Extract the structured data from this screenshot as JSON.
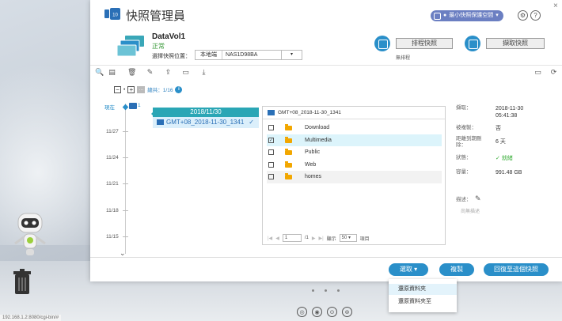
{
  "app": {
    "title": "快照管理員",
    "space_label": "最小快照保護空間",
    "close_glyph": "×",
    "gear_glyph": "⚙",
    "help_glyph": "?"
  },
  "volume": {
    "name": "DataVol1",
    "status": "正常",
    "select_location_label": "選擇快照位置：",
    "location_local": "本地端",
    "location_nas": "NAS1D98BA",
    "location_arrow": "▾"
  },
  "actions": {
    "schedule_label": "排程快照",
    "schedule_status": "無排程",
    "take_snapshot_label": "擷取快照"
  },
  "toolbar": {
    "icons": [
      "search-icon",
      "filter-icon",
      "trash-icon",
      "edit-icon",
      "upload-icon",
      "folder-open-icon",
      "download-icon",
      "window-icon",
      "refresh-icon"
    ],
    "glyphs": [
      "🔍",
      "▤",
      "🗑",
      "✎",
      "⇪",
      "▭",
      "⤓",
      "▭",
      "⟳"
    ]
  },
  "filter": {
    "tag_label": "…",
    "total_label": "總共：1/16",
    "info_glyph": "i",
    "minus_glyph": "−",
    "plus_glyph": "+"
  },
  "timeline": {
    "now_label": "現在",
    "now_count": "1",
    "dates": [
      "11/27",
      "11/24",
      "11/21",
      "11/18",
      "11/15"
    ],
    "chevron": "⌄"
  },
  "snapshot_list": {
    "date_header": "2018/11/30",
    "selected_snapshot": "GMT+08_2018-11-30_1341",
    "check_glyph": "✓"
  },
  "file_browser": {
    "header": "GMT+08_2018-11-30_1341",
    "rows": [
      {
        "name": "Download",
        "checked": false
      },
      {
        "name": "Multimedia",
        "checked": true
      },
      {
        "name": "Public",
        "checked": false
      },
      {
        "name": "Web",
        "checked": false
      },
      {
        "name": "homes",
        "checked": false
      }
    ],
    "pager": {
      "first": "|◀",
      "prev": "◀",
      "page_value": "1",
      "page_total": "/1",
      "next": "▶",
      "last": "▶|",
      "per_page_label": "顯示",
      "per_page_value": "50 ▾",
      "items_label": "項目"
    }
  },
  "properties": {
    "taken_label": "擷取：",
    "taken_value_date": "2018-11-30",
    "taken_value_time": "05:41:38",
    "replicated_label": "被複製：",
    "replicated_value": "否",
    "expire_label": "距離到期刪除：",
    "expire_value": "6 天",
    "state_label": "狀態：",
    "state_value": "就緒",
    "capacity_label": "容量：",
    "capacity_value": "991.48 GB",
    "description_label": "描述：",
    "description_empty": "尚無描述"
  },
  "footer": {
    "select_label": "選取 ▾",
    "copy_label": "複製",
    "restore_label": "回復至這個快照"
  },
  "dropdown": {
    "items": [
      "還原資料夾",
      "還原資料夾至"
    ]
  },
  "desktop": {
    "status_url": "192.168.1.2:8080/cgi-bin/#",
    "dock_glyphs": [
      "◎",
      "◉",
      "⊙",
      "⊚"
    ]
  },
  "colors": {
    "accent": "#2a8fc9",
    "teal": "#2aa6b5",
    "ok_green": "#3aae3a",
    "folder": "#f2a700",
    "pill": "#6b7fc2"
  }
}
